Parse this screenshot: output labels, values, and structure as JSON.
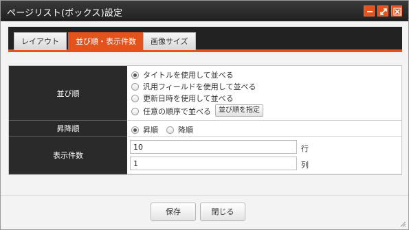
{
  "window": {
    "title": "ページリスト(ボックス)設定",
    "controls": [
      "minimize-icon",
      "maximize-icon",
      "close-icon"
    ],
    "accent_color": "#e3531b"
  },
  "tabs": [
    {
      "label": "レイアウト",
      "active": false
    },
    {
      "label": "並び順・表示件数",
      "active": true
    },
    {
      "label": "画像サイズ",
      "active": false
    }
  ],
  "form": {
    "sort": {
      "label": "並び順",
      "options": [
        {
          "label": "タイトルを使用して並べる",
          "checked": true
        },
        {
          "label": "汎用フィールドを使用して並べる",
          "checked": false
        },
        {
          "label": "更新日時を使用して並べる",
          "checked": false
        },
        {
          "label": "任意の順序で並べる",
          "checked": false
        }
      ],
      "button_label": "並び順を指定"
    },
    "direction": {
      "label": "昇降順",
      "options": [
        {
          "label": "昇順",
          "checked": true
        },
        {
          "label": "降順",
          "checked": false
        }
      ]
    },
    "count": {
      "label": "表示件数",
      "rows_value": "10",
      "rows_unit": "行",
      "cols_value": "1",
      "cols_unit": "列"
    }
  },
  "footer": {
    "save_label": "保存",
    "close_label": "閉じる"
  }
}
